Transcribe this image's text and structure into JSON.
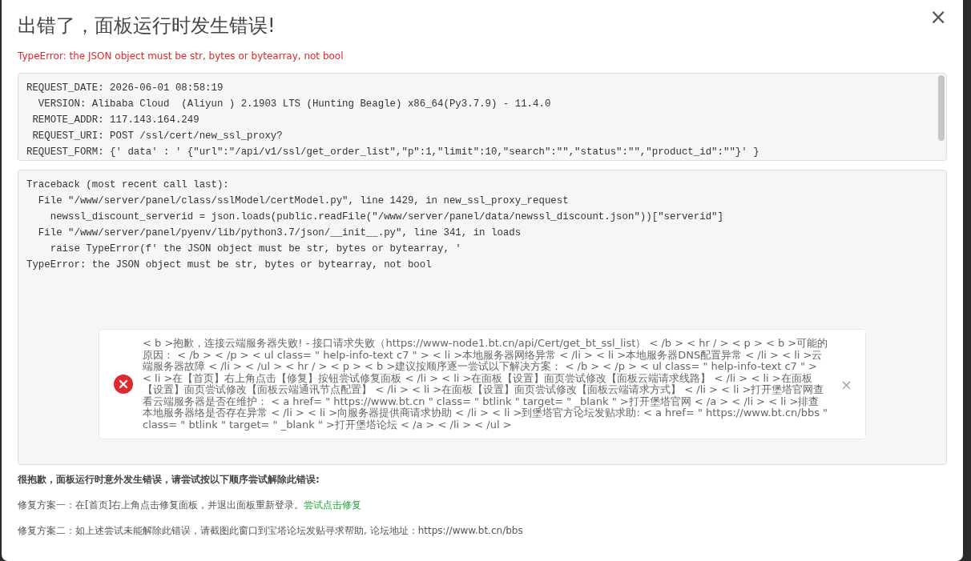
{
  "dialog": {
    "title": "出错了，面板运行时发生错误!",
    "error": "TypeError: the JSON object must be str, bytes or bytearray, not bool",
    "close": "×"
  },
  "request_info": [
    "REQUEST_DATE: 2026-06-01 08:58:19",
    "  VERSION: Alibaba Cloud  (Aliyun ) 2.1903 LTS (Hunting Beagle) x86_64(Py3.7.9) - 11.4.0",
    " REMOTE_ADDR: 117.143.164.249",
    " REQUEST_URI: POST /ssl/cert/new_ssl_proxy?",
    "REQUEST_FORM: {' data' : ' {\"url\":\"/api/v1/ssl/get_order_list\",\"p\":1,\"limit\":10,\"search\":\"\",\"status\":\"\",\"product_id\":\"\"}' }"
  ],
  "traceback": [
    "Traceback (most recent call last):",
    "  File \"/www/server/panel/class/sslModel/certModel.py\", line 1429, in new_ssl_proxy_request",
    "    newssl_discount_serverid = json.loads(public.readFile(\"/www/server/panel/data/newssl_discount.json\"))[\"serverid\"]",
    "  File \"/www/server/panel/pyenv/lib/python3.7/json/__init__.py\", line 341, in loads",
    "    raise TypeError(f' the JSON object must be str, bytes or bytearray, '",
    "TypeError: the JSON object must be str, bytes or bytearray, not bool"
  ],
  "toast": {
    "kind": "error",
    "message": "< b >抱歉，连接云端服务器失败! - 接口请求失败（https://www-node1.bt.cn/api/Cert/get_bt_ssl_list） < /b > < hr / > < p > < b >可能的原因： < /b > < /p > < ul class= \" help-info-text c7 \" > < li >本地服务器网络异常 < /li > < li >本地服务器DNS配置异常 < /li > < li >云端服务器故障 < /li > < /ul > < hr / > < p > < b >建议按顺序逐一尝试以下解决方案： < /b > < /p > < ul class= \" help-info-text c7 \" > < li >在【首页】右上角点击【修复】按钮尝试修复面板 < /li > < li >在面板【设置】面页尝试修改【面板云端请求线路】 < /li > < li >在面板【设置】面页尝试修改【面板云端通讯节点配置】 < /li > < li >在面板【设置】面页尝试修改【面板云端请求方式】 < /li > < li >打开堡塔官网查看云端服务器是否在维护： < a href= \" https://www.bt.cn \" class= \" btlink \" target= \" _blank \" >打开堡塔官网 < /a > < /li > < li >排查本地服务器络是否存在异常 < /li > < li >向服务器提供商请求协助 < /li > < li >到堡塔官方论坛发贴求助: < a href= \" https://www.bt.cn/bbs \" class= \" btlink \" target= \" _blank \" >打开堡塔论坛 < /a > < /li > < /ul >",
    "close": "×"
  },
  "help": {
    "heading": "很抱歉，面板运行时意外发生错误，请尝试按以下顺序尝试解除此错误:",
    "fix_1": "修复方案一：在[首页]右上角点击修复面板，并退出面板重新登录。",
    "fix_1_link": "尝试点击修复",
    "fix_2": "修复方案二：如上述尝试未能解除此错误，请截图此窗口到宝塔论坛发贴寻求帮助, 论坛地址：https://www.bt.cn/bbs"
  }
}
